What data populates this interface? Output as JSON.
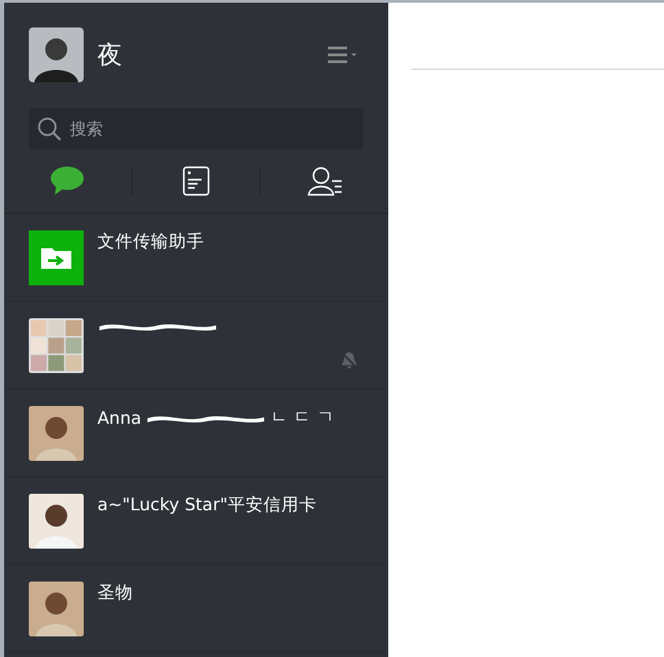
{
  "user": {
    "name": "夜"
  },
  "search": {
    "placeholder": "搜索"
  },
  "tabs": [
    {
      "kind": "chat",
      "selected": true
    },
    {
      "kind": "articles",
      "selected": false
    },
    {
      "kind": "contacts",
      "selected": false
    }
  ],
  "chats": [
    {
      "kind": "file",
      "name": "文件传输助手",
      "muted": false,
      "redacted": false
    },
    {
      "kind": "group",
      "muted": true,
      "redacted": true
    },
    {
      "kind": "person",
      "name": "Anna",
      "muted": false,
      "redacted": true,
      "suffix": "ㄴ ㄷ ㄱ"
    },
    {
      "kind": "person",
      "name": "a~\"Lucky Star\"平安信用卡",
      "muted": false,
      "redacted": false
    },
    {
      "kind": "person",
      "name": "圣物",
      "muted": false,
      "redacted": false
    }
  ]
}
